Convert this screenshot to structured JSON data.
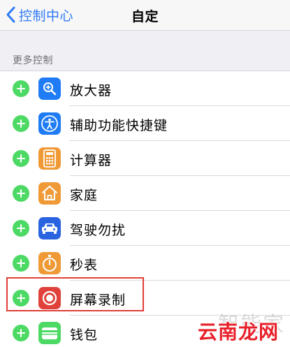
{
  "nav": {
    "back_label": "控制中心",
    "title": "自定"
  },
  "section": {
    "header": "更多控制"
  },
  "items": [
    {
      "label": "放大器",
      "icon": "magnifier-icon",
      "color": "#1f7cf4"
    },
    {
      "label": "辅助功能快捷键",
      "icon": "accessibility-icon",
      "color": "#1f7cf4"
    },
    {
      "label": "计算器",
      "icon": "calculator-icon",
      "color": "#f09a37"
    },
    {
      "label": "家庭",
      "icon": "home-icon",
      "color": "#f09a37"
    },
    {
      "label": "驾驶勿扰",
      "icon": "car-icon",
      "color": "#2a63e0"
    },
    {
      "label": "秒表",
      "icon": "stopwatch-icon",
      "color": "#f09a37"
    },
    {
      "label": "屏幕录制",
      "icon": "screen-record-icon",
      "color": "#e0423b"
    },
    {
      "label": "钱包",
      "icon": "wallet-icon",
      "color": "#4cd964"
    }
  ],
  "colors": {
    "accent": "#2f7bf5",
    "add_button": "#4cd964",
    "highlight_border": "#e03f36"
  },
  "watermark": {
    "top_text": "智能家",
    "brand_text": "云南龙网"
  }
}
